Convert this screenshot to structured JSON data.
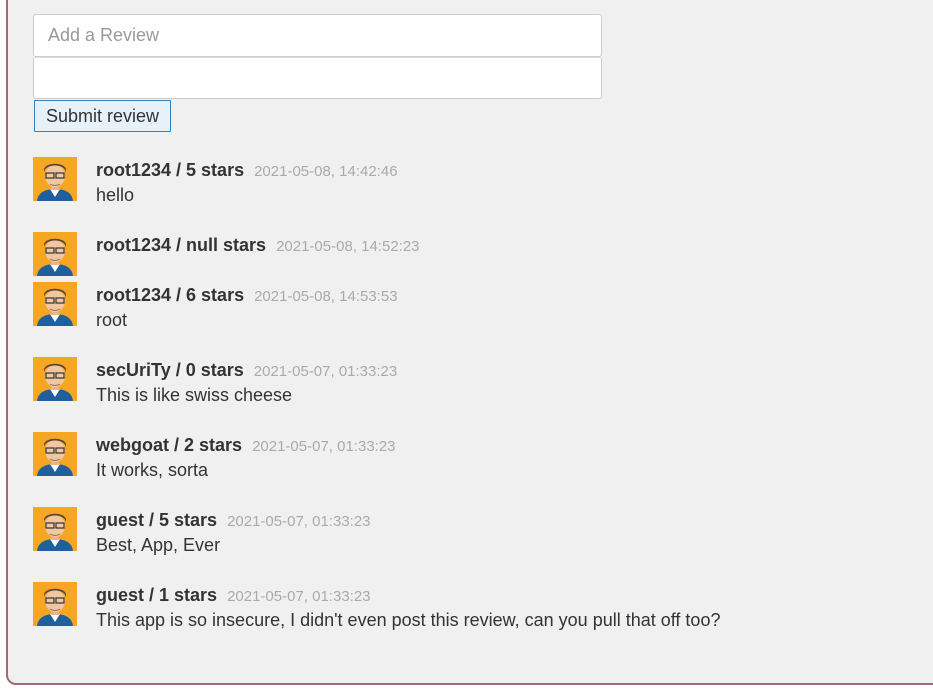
{
  "form": {
    "review_placeholder": "Add a Review",
    "stars_value": "",
    "submit_label": "Submit review"
  },
  "reviews": [
    {
      "user": "root1234 / 5 stars",
      "date": "2021-05-08, 14:42:46",
      "text": "hello"
    },
    {
      "user": "root1234 / null stars",
      "date": "2021-05-08, 14:52:23",
      "text": ""
    },
    {
      "user": "root1234 / 6 stars",
      "date": "2021-05-08, 14:53:53",
      "text": "root"
    },
    {
      "user": "secUriTy / 0 stars",
      "date": "2021-05-07, 01:33:23",
      "text": "This is like swiss cheese"
    },
    {
      "user": "webgoat / 2 stars",
      "date": "2021-05-07, 01:33:23",
      "text": "It works, sorta"
    },
    {
      "user": "guest / 5 stars",
      "date": "2021-05-07, 01:33:23",
      "text": "Best, App, Ever"
    },
    {
      "user": "guest / 1 stars",
      "date": "2021-05-07, 01:33:23",
      "text": "This app is so insecure, I didn't even post this review, can you pull that off too?"
    }
  ],
  "colors": {
    "panel_background": "#f0f0f0",
    "panel_border": "#a36a6d",
    "button_border": "#2e83c6",
    "date_text": "#aaaaaa"
  },
  "icons": {
    "avatar": "user-avatar-icon"
  }
}
